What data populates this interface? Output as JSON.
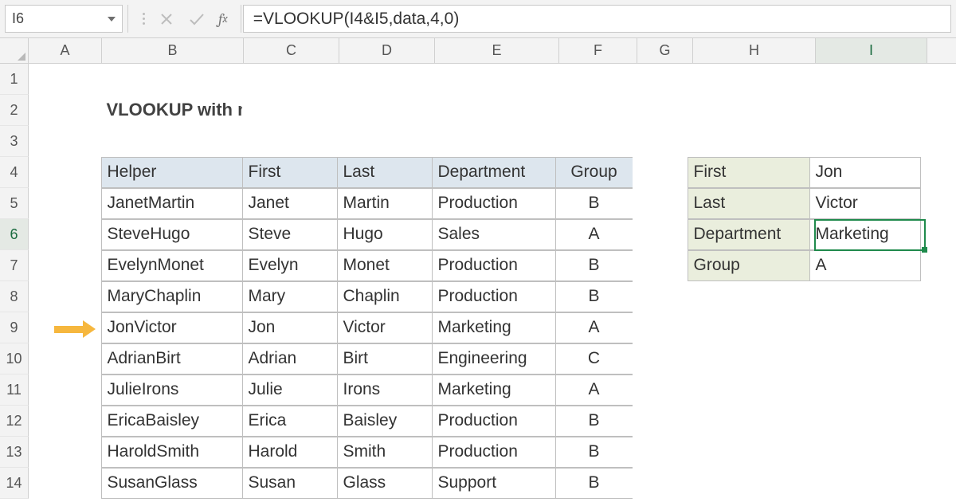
{
  "selected_cell_ref": "I6",
  "formula": "=VLOOKUP(I4&I5,data,4,0)",
  "columns": [
    "A",
    "B",
    "C",
    "D",
    "E",
    "F",
    "G",
    "H",
    "I"
  ],
  "row_numbers": [
    "1",
    "2",
    "3",
    "4",
    "5",
    "6",
    "7",
    "8",
    "9",
    "10",
    "11",
    "12",
    "13",
    "14"
  ],
  "title": "VLOOKUP with multiple criteria",
  "table": {
    "headers": [
      "Helper",
      "First",
      "Last",
      "Department",
      "Group"
    ],
    "rows": [
      [
        "JanetMartin",
        "Janet",
        "Martin",
        "Production",
        "B"
      ],
      [
        "SteveHugo",
        "Steve",
        "Hugo",
        "Sales",
        "A"
      ],
      [
        "EvelynMonet",
        "Evelyn",
        "Monet",
        "Production",
        "B"
      ],
      [
        "MaryChaplin",
        "Mary",
        "Chaplin",
        "Production",
        "B"
      ],
      [
        "JonVictor",
        "Jon",
        "Victor",
        "Marketing",
        "A"
      ],
      [
        "AdrianBirt",
        "Adrian",
        "Birt",
        "Engineering",
        "C"
      ],
      [
        "JulieIrons",
        "Julie",
        "Irons",
        "Marketing",
        "A"
      ],
      [
        "EricaBaisley",
        "Erica",
        "Baisley",
        "Production",
        "B"
      ],
      [
        "HaroldSmith",
        "Harold",
        "Smith",
        "Production",
        "B"
      ],
      [
        "SusanGlass",
        "Susan",
        "Glass",
        "Support",
        "B"
      ]
    ]
  },
  "lookup": {
    "rows": [
      {
        "label": "First",
        "value": "Jon"
      },
      {
        "label": "Last",
        "value": "Victor"
      },
      {
        "label": "Department",
        "value": "Marketing"
      },
      {
        "label": "Group",
        "value": "A"
      }
    ]
  },
  "arrow_row_index": 4
}
